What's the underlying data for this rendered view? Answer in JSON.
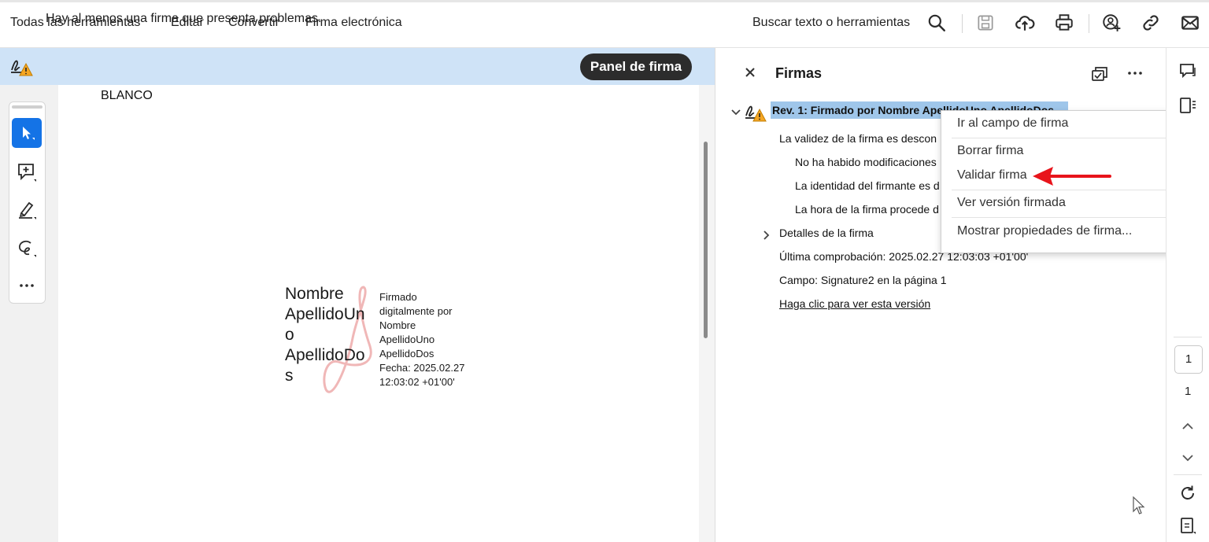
{
  "menu": {
    "items": [
      "Todas las herramientas",
      "Editar",
      "Convertir",
      "Firma electrónica"
    ],
    "search_label": "Buscar texto o herramientas"
  },
  "banner": {
    "message": "Hay al menos una firma que presenta problemas.",
    "panel_button": "Panel de firma"
  },
  "document": {
    "top_text": "BLANCO",
    "signature_name_lines": [
      "Nombre",
      "ApellidoUn",
      "o",
      "ApellidoDo",
      "s"
    ],
    "signature_detail_lines": [
      "Firmado",
      "digitalmente por",
      "Nombre",
      "ApellidoUno",
      "ApellidoDos",
      "Fecha: 2025.02.27",
      "12:03:02 +01'00'"
    ]
  },
  "signatures_panel": {
    "title": "Firmas",
    "revision": "Rev. 1: Firmado por Nombre ApellidoUno ApellidoDos",
    "validity": "La validez de la firma es descon",
    "checks": [
      "No ha habido modificaciones",
      "La identidad del firmante es d",
      "La hora de la firma procede d"
    ],
    "details": "Detalles de la firma",
    "last_check": "Última comprobación: 2025.02.27 12:03:03 +01'00'",
    "field": "Campo: Signature2 en la página 1",
    "view_version_link": "Haga clic para ver esta versión"
  },
  "context_menu": {
    "items": [
      "Ir al campo de firma",
      "Borrar firma",
      "Validar firma",
      "Ver versión firmada",
      "Mostrar propiedades de firma..."
    ]
  },
  "pagination": {
    "current_page": "1",
    "total_pages": "1"
  },
  "colors": {
    "banner_bg": "#cfe3f7",
    "selection_bg": "#9fc6ea",
    "active_tool": "#1473e6",
    "annotation_arrow": "#e8141b",
    "warning": "#f5a623"
  }
}
